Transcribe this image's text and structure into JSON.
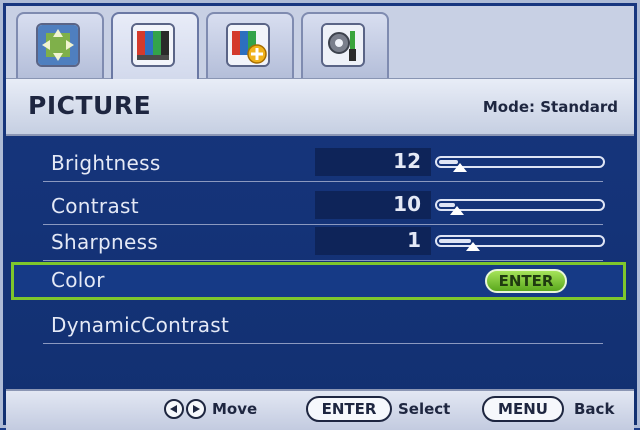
{
  "tabs": [
    {
      "icon": "display-position-icon"
    },
    {
      "icon": "picture-icon"
    },
    {
      "icon": "picture-advanced-icon"
    },
    {
      "icon": "system-settings-icon"
    }
  ],
  "header": {
    "title": "PICTURE",
    "mode": "Mode: Standard"
  },
  "menu": [
    {
      "label": "Brightness",
      "value": "12",
      "level": 0.12
    },
    {
      "label": "Contrast",
      "value": "10",
      "level": 0.1
    },
    {
      "label": "Sharpness",
      "value": "1",
      "level": 0.2
    },
    {
      "label": "Color",
      "action": "ENTER"
    },
    {
      "label": "DynamicContrast"
    }
  ],
  "footer": {
    "move": "Move",
    "enter_key": "ENTER",
    "select": "Select",
    "menu_key": "MENU",
    "back": "Back"
  },
  "colors": {
    "background": "#1b3c88",
    "highlight": "#7ec72c",
    "enter_button": "#6dbb25"
  }
}
